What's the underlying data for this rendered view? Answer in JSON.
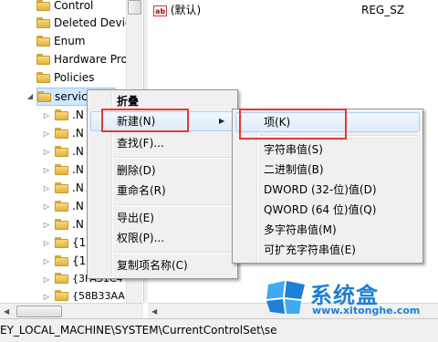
{
  "tree": {
    "items": [
      {
        "label": "Control"
      },
      {
        "label": "Deleted Devic"
      },
      {
        "label": "Enum"
      },
      {
        "label": "Hardware Pro"
      },
      {
        "label": "Policies"
      },
      {
        "label": "servic"
      },
      {
        "label": ".N"
      },
      {
        "label": ".N"
      },
      {
        "label": ".N"
      },
      {
        "label": ".N"
      },
      {
        "label": ".N"
      },
      {
        "label": ".N"
      },
      {
        "label": ".N"
      },
      {
        "label": "{1"
      },
      {
        "label": "{1"
      },
      {
        "label": "{3FA31C4"
      },
      {
        "label": "{58B33AA"
      }
    ]
  },
  "values": {
    "rows": [
      {
        "icon": "ab",
        "name": "(默认)",
        "type": "REG_SZ"
      }
    ]
  },
  "context_menu": {
    "items": [
      {
        "label": "折叠"
      },
      {
        "label": "新建(N)"
      },
      {
        "label": "查找(F)..."
      },
      {
        "label": "删除(D)"
      },
      {
        "label": "重命名(R)"
      },
      {
        "label": "导出(E)"
      },
      {
        "label": "权限(P)..."
      },
      {
        "label": "复制项名称(C)"
      }
    ],
    "submenu_arrow": "▶"
  },
  "submenu": {
    "items": [
      {
        "label": "项(K)"
      },
      {
        "label": "字符串值(S)"
      },
      {
        "label": "二进制值(B)"
      },
      {
        "label": "DWORD (32-位)值(D)"
      },
      {
        "label": "QWORD (64 位)值(Q)"
      },
      {
        "label": "多字符串值(M)"
      },
      {
        "label": "可扩充字符串值(E)"
      }
    ]
  },
  "status_bar": {
    "path": "EY_LOCAL_MACHINE\\SYSTEM\\CurrentControlSet\\se"
  },
  "watermark": {
    "brand": "系统盒",
    "url": "www.xitonghe.com"
  },
  "colors": {
    "highlight_border": "#e53935",
    "watermark_blue": "#1e7fd6"
  }
}
